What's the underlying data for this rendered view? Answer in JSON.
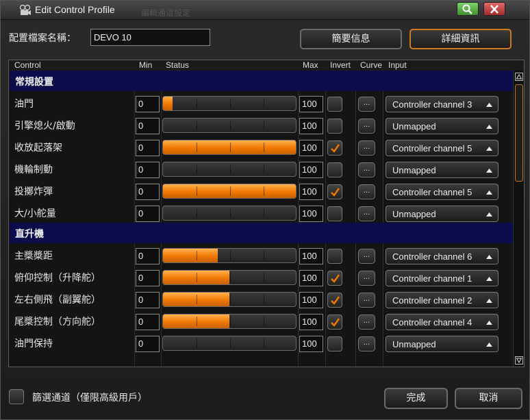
{
  "window": {
    "title": "Edit Control Profile",
    "ghost_title": "編輯通道設定"
  },
  "profile": {
    "label": "配置檔案名稱：",
    "value": "DEVO 10"
  },
  "top_buttons": {
    "summary": "簡要信息",
    "detail": "詳細資訊"
  },
  "columns": {
    "control": "Control",
    "min": "Min",
    "status": "Status",
    "max": "Max",
    "invert": "Invert",
    "curve": "Curve",
    "input": "Input"
  },
  "sections": [
    {
      "title": "常規設置",
      "rows": [
        {
          "label": "油門",
          "min": "0",
          "max": "100",
          "level": 0.07,
          "invert": false,
          "curve": "...",
          "input": "Controller channel 3"
        },
        {
          "label": "引擎熄火/啟動",
          "min": "0",
          "max": "100",
          "level": 0.0,
          "invert": false,
          "curve": "...",
          "input": "Unmapped"
        },
        {
          "label": "收放起落架",
          "min": "0",
          "max": "100",
          "level": 1.0,
          "invert": true,
          "curve": "...",
          "input": "Controller channel 5"
        },
        {
          "label": "機輪制動",
          "min": "0",
          "max": "100",
          "level": 0.0,
          "invert": false,
          "curve": "...",
          "input": "Unmapped"
        },
        {
          "label": "投擲炸彈",
          "min": "0",
          "max": "100",
          "level": 1.0,
          "invert": true,
          "curve": "...",
          "input": "Controller channel 5"
        },
        {
          "label": "大/小舵量",
          "min": "0",
          "max": "100",
          "level": 0.0,
          "invert": false,
          "curve": "...",
          "input": "Unmapped"
        }
      ]
    },
    {
      "title": "直升機",
      "rows": [
        {
          "label": "主槳槳距",
          "min": "0",
          "max": "100",
          "level": 0.41,
          "invert": false,
          "curve": "...",
          "input": "Controller channel 6"
        },
        {
          "label": "俯仰控制（升降舵）",
          "min": "0",
          "max": "100",
          "level": 0.5,
          "invert": true,
          "curve": "...",
          "input": "Controller channel 1"
        },
        {
          "label": "左右側飛（副翼舵）",
          "min": "0",
          "max": "100",
          "level": 0.5,
          "invert": true,
          "curve": "...",
          "input": "Controller channel 2"
        },
        {
          "label": "尾槳控制（方向舵）",
          "min": "0",
          "max": "100",
          "level": 0.5,
          "invert": true,
          "curve": "...",
          "input": "Controller channel 4"
        },
        {
          "label": "油門保持",
          "min": "0",
          "max": "100",
          "level": 0.0,
          "invert": false,
          "curve": "...",
          "input": "Unmapped"
        }
      ]
    }
  ],
  "footer": {
    "filter_label": "篩選通道（僅限高級用戶）",
    "ok": "完成",
    "cancel": "取消"
  },
  "colors": {
    "accent": "#f07800",
    "section_bg": "#0c0c4a"
  }
}
